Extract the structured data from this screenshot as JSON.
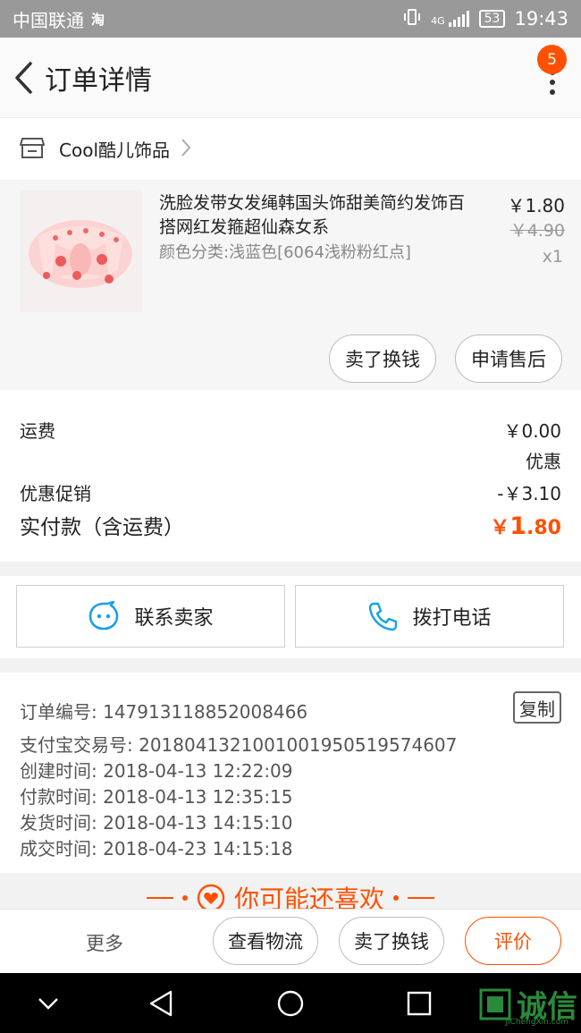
{
  "status_bar": {
    "carrier": "中国联通",
    "app_badge": "淘",
    "signal": "4G",
    "battery": "53",
    "time": "19:43"
  },
  "nav": {
    "title": "订单详情",
    "badge_count": "5"
  },
  "shop": {
    "name": "Cool酷儿饰品"
  },
  "product": {
    "title": "洗脸发带女发绳韩国头饰甜美简约发饰百搭网红发箍超仙森女系",
    "sku": "颜色分类:浅蓝色[6064浅粉粉红点]",
    "price": "￥1.80",
    "original_price": "￥4.90",
    "quantity": "x1",
    "sell_label": "卖了换钱",
    "after_sale_label": "申请售后"
  },
  "fees": {
    "shipping_label": "运费",
    "shipping_value": "￥0.00",
    "discount_note": "优惠",
    "promo_label": "优惠促销",
    "promo_value": "-￥3.10",
    "total_label": "实付款（含运费）",
    "total_currency": "￥",
    "total_int": "1",
    "total_dec": ".80"
  },
  "contact": {
    "seller_label": "联系卖家",
    "phone_label": "拨打电话"
  },
  "order_info": {
    "order_no": "订单编号: 147913118852008466",
    "copy_label": "复制",
    "alipay_no": "支付宝交易号: 2018041321001001950519574607",
    "created": "创建时间: 2018-04-13 12:22:09",
    "paid": "付款时间: 2018-04-13 12:35:15",
    "shipped": "发货时间: 2018-04-13 14:15:10",
    "completed": "成交时间: 2018-04-23 14:15:18"
  },
  "recommend": {
    "title": "你可能还喜欢"
  },
  "bottom_bar": {
    "more": "更多",
    "logistics": "查看物流",
    "sell": "卖了换钱",
    "rate": "评价"
  },
  "watermark": {
    "text": "诚信",
    "sub": "JiChengXin.com"
  },
  "colors": {
    "accent": "#ff5000",
    "contact_icon": "#1aa1e8"
  }
}
